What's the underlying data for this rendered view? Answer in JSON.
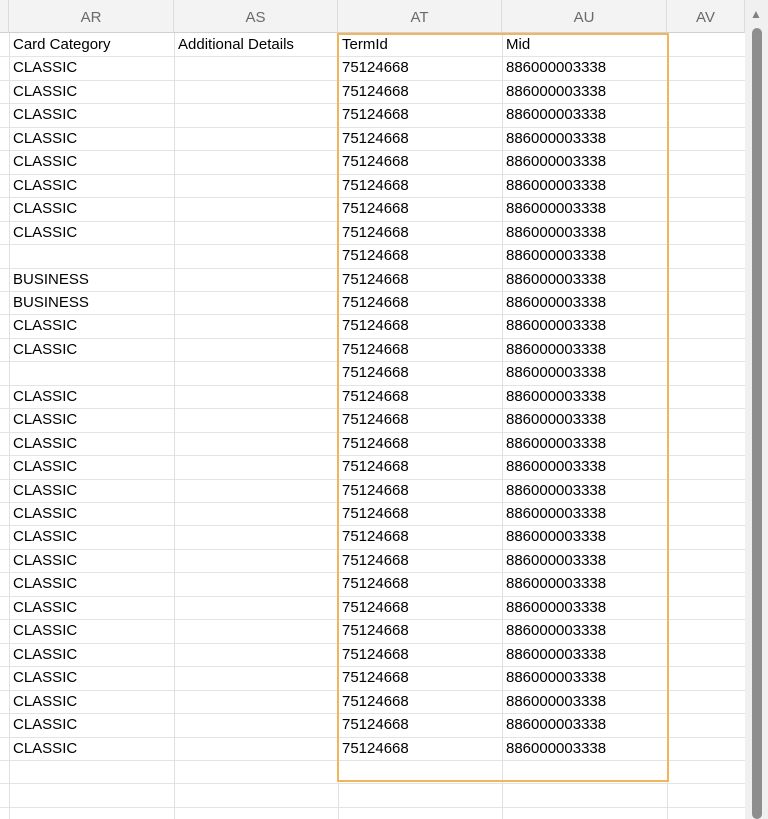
{
  "columns": [
    "AR",
    "AS",
    "AT",
    "AU",
    "AV"
  ],
  "header_row": [
    "Card Category",
    "Additional Details",
    "TermId",
    "Mid"
  ],
  "rows": [
    [
      "CLASSIC",
      "",
      "75124668",
      "886000003338"
    ],
    [
      "CLASSIC",
      "",
      "75124668",
      "886000003338"
    ],
    [
      "CLASSIC",
      "",
      "75124668",
      "886000003338"
    ],
    [
      "CLASSIC",
      "",
      "75124668",
      "886000003338"
    ],
    [
      "CLASSIC",
      "",
      "75124668",
      "886000003338"
    ],
    [
      "CLASSIC",
      "",
      "75124668",
      "886000003338"
    ],
    [
      "CLASSIC",
      "",
      "75124668",
      "886000003338"
    ],
    [
      "CLASSIC",
      "",
      "75124668",
      "886000003338"
    ],
    [
      "",
      "",
      "75124668",
      "886000003338"
    ],
    [
      "BUSINESS",
      "",
      "75124668",
      "886000003338"
    ],
    [
      "BUSINESS",
      "",
      "75124668",
      "886000003338"
    ],
    [
      "CLASSIC",
      "",
      "75124668",
      "886000003338"
    ],
    [
      "CLASSIC",
      "",
      "75124668",
      "886000003338"
    ],
    [
      "",
      "",
      "75124668",
      "886000003338"
    ],
    [
      "CLASSIC",
      "",
      "75124668",
      "886000003338"
    ],
    [
      "CLASSIC",
      "",
      "75124668",
      "886000003338"
    ],
    [
      "CLASSIC",
      "",
      "75124668",
      "886000003338"
    ],
    [
      "CLASSIC",
      "",
      "75124668",
      "886000003338"
    ],
    [
      "CLASSIC",
      "",
      "75124668",
      "886000003338"
    ],
    [
      "CLASSIC",
      "",
      "75124668",
      "886000003338"
    ],
    [
      "CLASSIC",
      "",
      "75124668",
      "886000003338"
    ],
    [
      "CLASSIC",
      "",
      "75124668",
      "886000003338"
    ],
    [
      "CLASSIC",
      "",
      "75124668",
      "886000003338"
    ],
    [
      "CLASSIC",
      "",
      "75124668",
      "886000003338"
    ],
    [
      "CLASSIC",
      "",
      "75124668",
      "886000003338"
    ],
    [
      "CLASSIC",
      "",
      "75124668",
      "886000003338"
    ],
    [
      "CLASSIC",
      "",
      "75124668",
      "886000003338"
    ],
    [
      "CLASSIC",
      "",
      "75124668",
      "886000003338"
    ],
    [
      "CLASSIC",
      "",
      "75124668",
      "886000003338"
    ],
    [
      "CLASSIC",
      "",
      "75124668",
      "886000003338"
    ]
  ],
  "highlight_color": "#f2b65a",
  "icons": {
    "scroll_up": "triangle-up-icon"
  }
}
